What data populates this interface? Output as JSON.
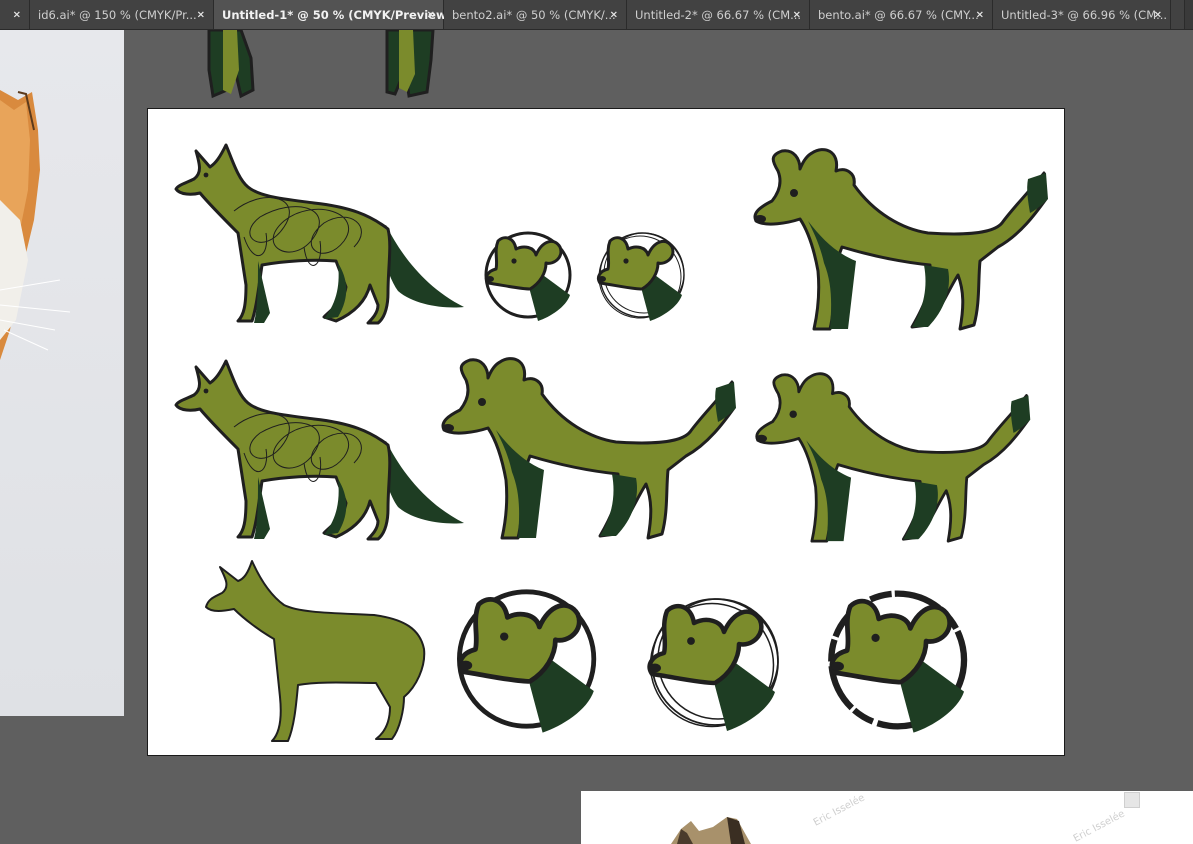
{
  "tabs": [
    {
      "label": ""
    },
    {
      "label": "id6.ai* @ 150 % (CMYK/Pr..."
    },
    {
      "label": "Untitled-1* @ 50 % (CMYK/Preview)"
    },
    {
      "label": "bento2.ai* @ 50 % (CMYK/..."
    },
    {
      "label": "Untitled-2* @ 66.67 % (CM..."
    },
    {
      "label": "bento.ai* @ 66.67 % (CMY..."
    },
    {
      "label": "Untitled-3* @ 66.96 % (CM..."
    }
  ],
  "active_tab_index": 2,
  "close_glyph": "×",
  "watermark_text": "Eric Isselée",
  "colors": {
    "light_green": "#7b8b2c",
    "dark_green": "#1e3d23",
    "outline": "#1f1f1f",
    "pasteboard": "#5f5f5f",
    "tab_bar": "#3a3a3a"
  }
}
